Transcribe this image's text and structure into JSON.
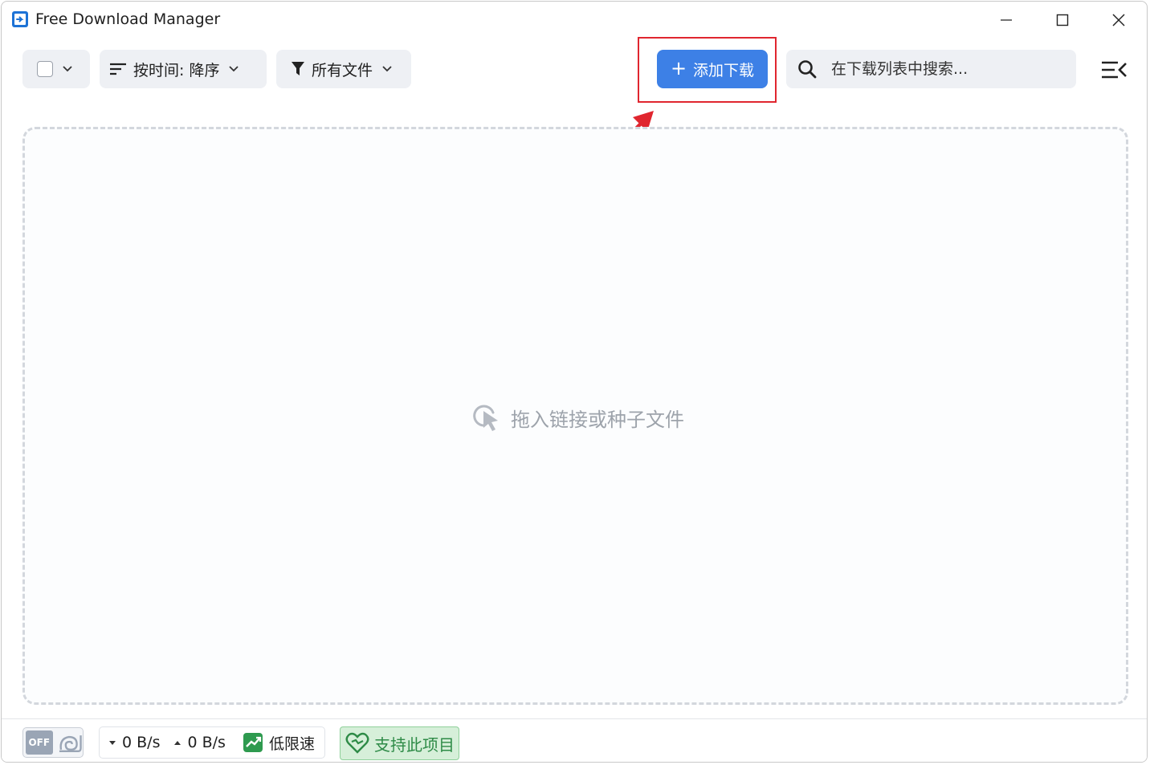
{
  "window": {
    "title": "Free Download Manager"
  },
  "toolbar": {
    "sort_label": "按时间: 降序",
    "filter_label": "所有文件",
    "add_label": "添加下载",
    "search_placeholder": "在下载列表中搜索..."
  },
  "dropzone": {
    "hint": "拖入链接或种子文件"
  },
  "statusbar": {
    "snail_state": "OFF",
    "download_speed": "0 B/s",
    "upload_speed": "0 B/s",
    "speed_mode": "低限速",
    "support_label": "支持此项目"
  },
  "colors": {
    "accent": "#3d80e6",
    "annotation": "#e0262f",
    "support_green": "#2e8b47"
  },
  "icons": [
    "app-logo-icon",
    "minimize-icon",
    "maximize-icon",
    "close-icon",
    "chevron-down-icon",
    "sort-icon",
    "filter-icon",
    "plus-icon",
    "search-icon",
    "menu-collapse-icon",
    "drag-drop-icon",
    "snail-icon",
    "speed-limit-icon",
    "heart-icon"
  ]
}
